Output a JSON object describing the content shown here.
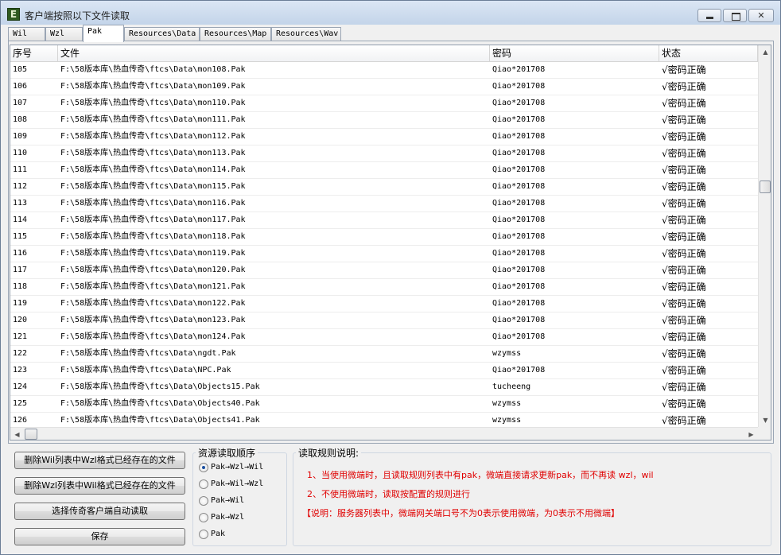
{
  "window": {
    "title": "客户端按照以下文件读取",
    "app_icon_letter": "E"
  },
  "tabs": [
    {
      "label": "Wil",
      "active": false
    },
    {
      "label": "Wzl",
      "active": false
    },
    {
      "label": "Pak",
      "active": true
    },
    {
      "label": "Resources\\Data",
      "active": false
    },
    {
      "label": "Resources\\Map",
      "active": false
    },
    {
      "label": "Resources\\Wav",
      "active": false
    }
  ],
  "table": {
    "columns": [
      "序号",
      "文件",
      "密码",
      "状态"
    ],
    "rows": [
      [
        "105",
        "F:\\58版本库\\热血传奇\\ftcs\\Data\\mon108.Pak",
        "Qiao*201708",
        "√密码正确"
      ],
      [
        "106",
        "F:\\58版本库\\热血传奇\\ftcs\\Data\\mon109.Pak",
        "Qiao*201708",
        "√密码正确"
      ],
      [
        "107",
        "F:\\58版本库\\热血传奇\\ftcs\\Data\\mon110.Pak",
        "Qiao*201708",
        "√密码正确"
      ],
      [
        "108",
        "F:\\58版本库\\热血传奇\\ftcs\\Data\\mon111.Pak",
        "Qiao*201708",
        "√密码正确"
      ],
      [
        "109",
        "F:\\58版本库\\热血传奇\\ftcs\\Data\\mon112.Pak",
        "Qiao*201708",
        "√密码正确"
      ],
      [
        "110",
        "F:\\58版本库\\热血传奇\\ftcs\\Data\\mon113.Pak",
        "Qiao*201708",
        "√密码正确"
      ],
      [
        "111",
        "F:\\58版本库\\热血传奇\\ftcs\\Data\\mon114.Pak",
        "Qiao*201708",
        "√密码正确"
      ],
      [
        "112",
        "F:\\58版本库\\热血传奇\\ftcs\\Data\\mon115.Pak",
        "Qiao*201708",
        "√密码正确"
      ],
      [
        "113",
        "F:\\58版本库\\热血传奇\\ftcs\\Data\\mon116.Pak",
        "Qiao*201708",
        "√密码正确"
      ],
      [
        "114",
        "F:\\58版本库\\热血传奇\\ftcs\\Data\\mon117.Pak",
        "Qiao*201708",
        "√密码正确"
      ],
      [
        "115",
        "F:\\58版本库\\热血传奇\\ftcs\\Data\\mon118.Pak",
        "Qiao*201708",
        "√密码正确"
      ],
      [
        "116",
        "F:\\58版本库\\热血传奇\\ftcs\\Data\\mon119.Pak",
        "Qiao*201708",
        "√密码正确"
      ],
      [
        "117",
        "F:\\58版本库\\热血传奇\\ftcs\\Data\\mon120.Pak",
        "Qiao*201708",
        "√密码正确"
      ],
      [
        "118",
        "F:\\58版本库\\热血传奇\\ftcs\\Data\\mon121.Pak",
        "Qiao*201708",
        "√密码正确"
      ],
      [
        "119",
        "F:\\58版本库\\热血传奇\\ftcs\\Data\\mon122.Pak",
        "Qiao*201708",
        "√密码正确"
      ],
      [
        "120",
        "F:\\58版本库\\热血传奇\\ftcs\\Data\\mon123.Pak",
        "Qiao*201708",
        "√密码正确"
      ],
      [
        "121",
        "F:\\58版本库\\热血传奇\\ftcs\\Data\\mon124.Pak",
        "Qiao*201708",
        "√密码正确"
      ],
      [
        "122",
        "F:\\58版本库\\热血传奇\\ftcs\\Data\\ngdt.Pak",
        "wzymss",
        "√密码正确"
      ],
      [
        "123",
        "F:\\58版本库\\热血传奇\\ftcs\\Data\\NPC.Pak",
        "Qiao*201708",
        "√密码正确"
      ],
      [
        "124",
        "F:\\58版本库\\热血传奇\\ftcs\\Data\\Objects15.Pak",
        "tucheeng",
        "√密码正确"
      ],
      [
        "125",
        "F:\\58版本库\\热血传奇\\ftcs\\Data\\Objects40.Pak",
        "wzymss",
        "√密码正确"
      ],
      [
        "126",
        "F:\\58版本库\\热血传奇\\ftcs\\Data\\Objects41.Pak",
        "wzymss",
        "√密码正确"
      ]
    ]
  },
  "buttons": {
    "delete_wil": "删除Wil列表中Wzl格式已经存在的文件",
    "delete_wzl": "删除Wzl列表中Wil格式已经存在的文件",
    "auto_read": "选择传奇客户端自动读取",
    "save": "保存"
  },
  "order_group": {
    "label": "资源读取顺序",
    "options": [
      {
        "label": "Pak→Wzl→Wil",
        "selected": true
      },
      {
        "label": "Pak→Wil→Wzl",
        "selected": false
      },
      {
        "label": "Pak→Wil",
        "selected": false
      },
      {
        "label": "Pak→Wzl",
        "selected": false
      },
      {
        "label": "Pak",
        "selected": false
      }
    ]
  },
  "rules_group": {
    "label": "读取规则说明:",
    "lines": [
      "1、当使用微端时，且读取规则列表中有pak，微端直接请求更新pak，而不再读 wzl，wil",
      "2、不使用微端时，读取按配置的规则进行",
      "【说明：服务器列表中，微端网关端口号不为0表示使用微端，为0表示不用微端】"
    ],
    "text_color": "#e00000"
  }
}
